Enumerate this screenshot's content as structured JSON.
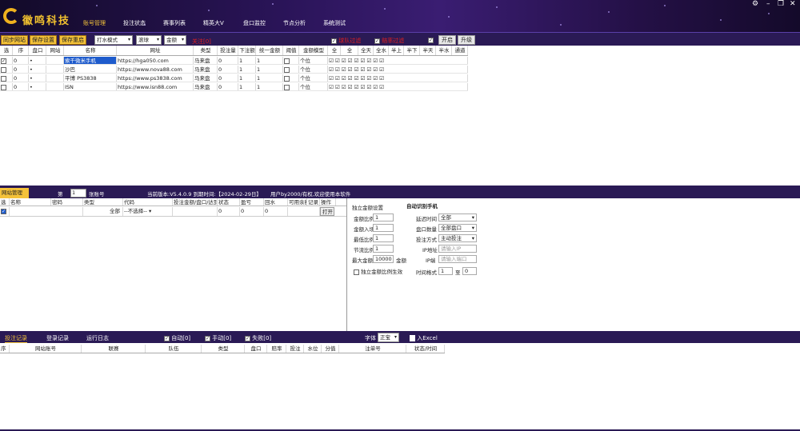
{
  "app": {
    "logo_text": "徽鸣科技",
    "accent": "#f4c23a",
    "dark": "#2a1a55"
  },
  "nav": [
    "账号管理",
    "投注状态",
    "赛事列表",
    "精英大V",
    "盘口监控",
    "节点分析",
    "系统测试"
  ],
  "toolbar": {
    "buttons": [
      "同步网站",
      "保存设置",
      "保存重启"
    ],
    "dropdowns": [
      "打水模式",
      "滚球",
      "金额"
    ],
    "status": "关注[0]",
    "checks": [
      "球队过滤",
      "赔率过滤"
    ],
    "buttons2": [
      "开启",
      "升级"
    ]
  },
  "grid1": {
    "headers": [
      "选",
      "序",
      "盘口",
      "网站",
      "名称",
      "网址",
      "类型",
      "投注量",
      "下注额",
      "倍数",
      "统一金额",
      "阈值",
      "金额模型",
      "全",
      "全",
      "全天",
      "全水",
      "半上",
      "半下",
      "半天",
      "半水",
      "通道"
    ],
    "rows": [
      {
        "checked": true,
        "seq": "0",
        "name": "索千微米手机",
        "url": "https://hga050.com",
        "type": "马来盘",
        "amount": "0",
        "mult": "1",
        "unified": "1",
        "model": "个位"
      },
      {
        "checked": false,
        "seq": "0",
        "name": "沙巴",
        "url": "https://www.nova88.com",
        "type": "马来盘",
        "amount": "0",
        "mult": "1",
        "unified": "1",
        "model": "个位"
      },
      {
        "checked": false,
        "seq": "0",
        "name": "平博 PS3838",
        "url": "https://www.ps3838.com",
        "type": "马来盘",
        "amount": "0",
        "mult": "1",
        "unified": "1",
        "model": "个位"
      },
      {
        "checked": false,
        "seq": "0",
        "name": "ISN",
        "url": "https://www.isn88.com",
        "type": "马来盘",
        "amount": "0",
        "mult": "1",
        "unified": "1",
        "model": "个位"
      }
    ]
  },
  "midbar": {
    "site_tag": "网站管理",
    "page_label": "第",
    "page_value": "1",
    "page_suffix": "张账号",
    "version": "当前版本:V5.4.0.9 到期时间:【2024-02-29日】",
    "notice": "用户by2000/有权,欢迎使用本软件"
  },
  "grid2": {
    "headers": [
      "选",
      "名称",
      "密码",
      "类型",
      "代码",
      "投注金额/盘口/达到",
      "状态",
      "盈亏",
      "回水",
      "可用余额",
      "记录",
      "操作"
    ],
    "row": {
      "type": "全部",
      "code": "--不选择--",
      "state": "0",
      "b1": "0",
      "b2": "0",
      "action": "打开"
    }
  },
  "rpanel": {
    "section1": "独立金额设置",
    "section2": "自动识别手机",
    "rows_left": [
      {
        "label": "金额比例",
        "value": "1"
      },
      {
        "label": "金额入场",
        "value": "1"
      },
      {
        "label": "最低比例",
        "value": "1"
      },
      {
        "label": "节流比例",
        "value": "1"
      },
      {
        "label": "最大金额",
        "value": "10000",
        "suffix": "金额"
      }
    ],
    "check_label": "独立金额比例生效",
    "rows_right": [
      {
        "label": "延迟时间",
        "value": "全部"
      },
      {
        "label": "盘口数量",
        "value": "全部盘口"
      },
      {
        "label": "投注方式",
        "value": "主动投注"
      },
      {
        "label": "IP地址",
        "value": "请输入IP"
      },
      {
        "label": "IP端",
        "value": "请输入端口"
      },
      {
        "label": "时间格式",
        "value": "1",
        "value2": "0"
      }
    ],
    "to_label": "至"
  },
  "bottombar": {
    "tabs": [
      "投注记录",
      "登录记录",
      "运行日志"
    ],
    "checks": [
      "自动[0]",
      "手动[0]",
      "失败[0]"
    ],
    "font_label": "字体",
    "font_value": "正宝",
    "export_label": "入Excel"
  },
  "grid3": {
    "headers": [
      "序",
      "网站账号",
      "联赛",
      "队伍",
      "类型",
      "盘口",
      "赔率",
      "投注",
      "水位",
      "分值",
      "注单号",
      "状态/时间"
    ]
  }
}
